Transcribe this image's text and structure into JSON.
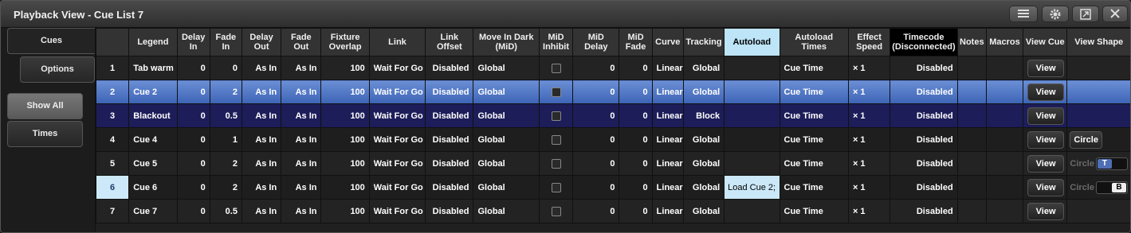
{
  "window": {
    "title": "Playback View - Cue List 7"
  },
  "sidebar": {
    "tabs": [
      {
        "label": "Cues"
      },
      {
        "label": "Options"
      }
    ],
    "show_all": "Show All",
    "times": "Times"
  },
  "columns": [
    "",
    "Legend",
    "Delay In",
    "Fade In",
    "Delay Out",
    "Fade Out",
    "Fixture Overlap",
    "Link",
    "Link Offset",
    "Move In Dark (MiD)",
    "MiD Inhibit",
    "MiD Delay",
    "MiD Fade",
    "Curve",
    "Tracking",
    "Autoload",
    "Autoload Times",
    "Effect Speed",
    "Timecode (Disconnected)",
    "Notes",
    "Macros",
    "View Cue",
    "View Shape"
  ],
  "column_lines": [
    [
      ""
    ],
    [
      "Legend"
    ],
    [
      "Delay",
      "In"
    ],
    [
      "Fade",
      "In"
    ],
    [
      "Delay",
      "Out"
    ],
    [
      "Fade",
      "Out"
    ],
    [
      "Fixture",
      "Overlap"
    ],
    [
      "Link"
    ],
    [
      "Link",
      "Offset"
    ],
    [
      "Move In Dark",
      "(MiD)"
    ],
    [
      "MiD",
      "Inhibit"
    ],
    [
      "MiD",
      "Delay"
    ],
    [
      "MiD",
      "Fade"
    ],
    [
      "Curve"
    ],
    [
      "Tracking"
    ],
    [
      "Autoload"
    ],
    [
      "Autoload Times"
    ],
    [
      "Effect",
      "Speed"
    ],
    [
      "Timecode",
      "(Disconnected)"
    ],
    [
      "Notes"
    ],
    [
      "Macros"
    ],
    [
      "View Cue"
    ],
    [
      "View Shape"
    ]
  ],
  "rows": [
    {
      "num": "1",
      "legend": "Tab warm",
      "delay_in": "0",
      "fade_in": "0",
      "delay_out": "As In",
      "fade_out": "As In",
      "overlap": "100",
      "link": "Wait For Go",
      "link_offset": "Disabled",
      "mid": "Global",
      "mid_delay": "0",
      "mid_fade": "0",
      "curve": "Linear",
      "tracking": "Global",
      "autoload": "",
      "autoload_times": "Cue Time",
      "effect_speed": "× 1",
      "timecode": "Disabled",
      "notes": "",
      "macros": "",
      "view_cue": "View",
      "view_shape": "",
      "shape_toggle": ""
    },
    {
      "num": "2",
      "legend": "Cue 2",
      "delay_in": "0",
      "fade_in": "2",
      "delay_out": "As In",
      "fade_out": "As In",
      "overlap": "100",
      "link": "Wait For Go",
      "link_offset": "Disabled",
      "mid": "Global",
      "mid_delay": "0",
      "mid_fade": "0",
      "curve": "Linear",
      "tracking": "Global",
      "autoload": "",
      "autoload_times": "Cue Time",
      "effect_speed": "× 1",
      "timecode": "Disabled",
      "notes": "",
      "macros": "",
      "view_cue": "View",
      "view_shape": "",
      "shape_toggle": ""
    },
    {
      "num": "3",
      "legend": "Blackout",
      "delay_in": "0",
      "fade_in": "0.5",
      "delay_out": "As In",
      "fade_out": "As In",
      "overlap": "100",
      "link": "Wait For Go",
      "link_offset": "Disabled",
      "mid": "Global",
      "mid_delay": "0",
      "mid_fade": "0",
      "curve": "Linear",
      "tracking": "Block",
      "autoload": "",
      "autoload_times": "Cue Time",
      "effect_speed": "× 1",
      "timecode": "Disabled",
      "notes": "",
      "macros": "",
      "view_cue": "View",
      "view_shape": "",
      "shape_toggle": ""
    },
    {
      "num": "4",
      "legend": "Cue 4",
      "delay_in": "0",
      "fade_in": "1",
      "delay_out": "As In",
      "fade_out": "As In",
      "overlap": "100",
      "link": "Wait For Go",
      "link_offset": "Disabled",
      "mid": "Global",
      "mid_delay": "0",
      "mid_fade": "0",
      "curve": "Linear",
      "tracking": "Global",
      "autoload": "",
      "autoload_times": "Cue Time",
      "effect_speed": "× 1",
      "timecode": "Disabled",
      "notes": "",
      "macros": "",
      "view_cue": "View",
      "view_shape": "Circle",
      "shape_toggle": ""
    },
    {
      "num": "5",
      "legend": "Cue 5",
      "delay_in": "0",
      "fade_in": "2",
      "delay_out": "As In",
      "fade_out": "As In",
      "overlap": "100",
      "link": "Wait For Go",
      "link_offset": "Disabled",
      "mid": "Global",
      "mid_delay": "0",
      "mid_fade": "0",
      "curve": "Linear",
      "tracking": "Global",
      "autoload": "",
      "autoload_times": "Cue Time",
      "effect_speed": "× 1",
      "timecode": "Disabled",
      "notes": "",
      "macros": "",
      "view_cue": "View",
      "view_shape": "Circle",
      "shape_toggle": "T"
    },
    {
      "num": "6",
      "legend": "Cue 6",
      "delay_in": "0",
      "fade_in": "2",
      "delay_out": "As In",
      "fade_out": "As In",
      "overlap": "100",
      "link": "Wait For Go",
      "link_offset": "Disabled",
      "mid": "Global",
      "mid_delay": "0",
      "mid_fade": "0",
      "curve": "Linear",
      "tracking": "Global",
      "autoload": "Load Cue 2;",
      "autoload_times": "Cue Time",
      "effect_speed": "× 1",
      "timecode": "Disabled",
      "notes": "",
      "macros": "",
      "view_cue": "View",
      "view_shape": "Circle",
      "shape_toggle": "B"
    },
    {
      "num": "7",
      "legend": "Cue 7",
      "delay_in": "0",
      "fade_in": "0.5",
      "delay_out": "As In",
      "fade_out": "As In",
      "overlap": "100",
      "link": "Wait For Go",
      "link_offset": "Disabled",
      "mid": "Global",
      "mid_delay": "0",
      "mid_fade": "0",
      "curve": "Linear",
      "tracking": "Global",
      "autoload": "",
      "autoload_times": "Cue Time",
      "effect_speed": "× 1",
      "timecode": "Disabled",
      "notes": "",
      "macros": "",
      "view_cue": "View",
      "view_shape": "",
      "shape_toggle": ""
    }
  ],
  "icons": {
    "menu": "menu-icon",
    "settings": "gear-icon",
    "restore": "restore-icon",
    "close": "close-icon"
  },
  "colors": {
    "selected_row": "#4f75c7",
    "block_row": "#1d1d5a",
    "autoload_header": "#bde4f7",
    "current_cue": "#cde9f9"
  }
}
